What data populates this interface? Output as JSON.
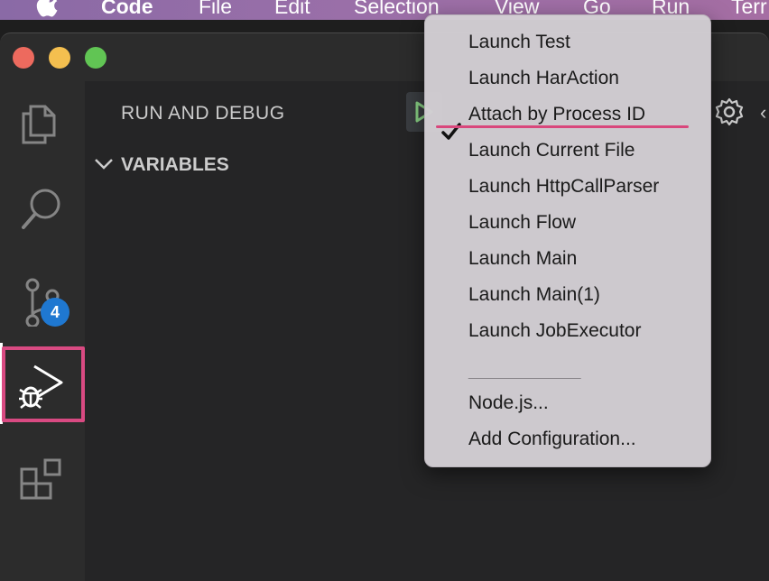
{
  "menubar": {
    "app_name": "Code",
    "items": [
      "File",
      "Edit",
      "Selection",
      "View",
      "Go",
      "Run",
      "Terr"
    ]
  },
  "activitybar": {
    "icons": [
      "files-icon",
      "search-icon",
      "source-control-icon",
      "run-debug-icon",
      "extensions-icon"
    ],
    "scm_badge": "4"
  },
  "sidebar": {
    "title": "RUN AND DEBUG",
    "section": "VARIABLES"
  },
  "dropdown": {
    "items": [
      "Launch Test",
      "Launch HarAction",
      "Attach by Process ID",
      "Launch Current File",
      "Launch HttpCallParser",
      "Launch Flow",
      "Launch Main",
      "Launch Main(1)",
      "Launch JobExecutor"
    ],
    "selected": "Attach by Process ID",
    "separator": "______________",
    "extra_items": [
      "Node.js...",
      "Add Configuration..."
    ]
  },
  "colors": {
    "highlight": "#d94a82",
    "badge": "#1f78d1",
    "play": "#89d185"
  }
}
